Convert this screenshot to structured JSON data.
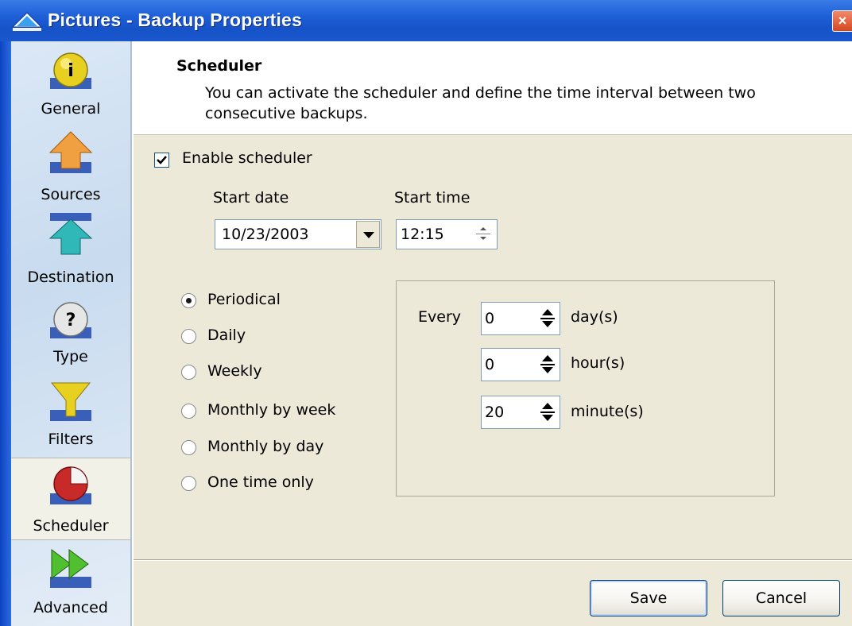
{
  "window": {
    "title": "Pictures - Backup Properties",
    "close_label": "×"
  },
  "sidebar": {
    "items": [
      {
        "label": "General",
        "icon": "info-icon"
      },
      {
        "label": "Sources",
        "icon": "sources-arrow-icon"
      },
      {
        "label": "Destination",
        "icon": "destination-arrow-icon"
      },
      {
        "label": "Type",
        "icon": "help-icon"
      },
      {
        "label": "Filters",
        "icon": "funnel-icon"
      },
      {
        "label": "Scheduler",
        "icon": "pie-icon"
      },
      {
        "label": "Advanced",
        "icon": "double-arrow-icon"
      }
    ],
    "active": "Scheduler"
  },
  "header": {
    "title": "Scheduler",
    "description": "You can activate the scheduler and define the time interval between two consecutive backups."
  },
  "form": {
    "enable_scheduler_label": "Enable scheduler",
    "enable_scheduler_checked": true,
    "start_date_label": "Start date",
    "start_date_value": "10/23/2003",
    "start_time_label": "Start time",
    "start_time_value": "12:15",
    "schedule_options": [
      {
        "label": "Periodical",
        "checked": true
      },
      {
        "label": "Daily",
        "checked": false
      },
      {
        "label": "Weekly",
        "checked": false
      },
      {
        "label": "Monthly by week",
        "checked": false
      },
      {
        "label": "Monthly by day",
        "checked": false
      },
      {
        "label": "One time only",
        "checked": false
      }
    ],
    "every_label": "Every",
    "intervals": [
      {
        "value": "0",
        "unit": "day(s)"
      },
      {
        "value": "0",
        "unit": "hour(s)"
      },
      {
        "value": "20",
        "unit": "minute(s)"
      }
    ]
  },
  "buttons": {
    "save": "Save",
    "cancel": "Cancel"
  },
  "colors": {
    "titlebar": "#1d5fd6",
    "dialog_bg": "#ece9d8",
    "sidebar_bg": "#d6e4f3"
  }
}
